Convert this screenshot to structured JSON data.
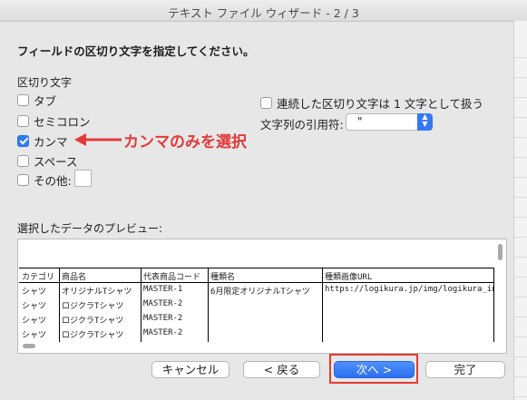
{
  "window": {
    "title": "テキスト ファイル ウィザード - 2 / 3"
  },
  "instruction": "フィールドの区切り文字を指定してください。",
  "delimiters": {
    "section_label": "区切り文字",
    "options": [
      {
        "label": "タブ",
        "checked": false
      },
      {
        "label": "セミコロン",
        "checked": false
      },
      {
        "label": "カンマ",
        "checked": true
      },
      {
        "label": "スペース",
        "checked": false
      },
      {
        "label": "その他:",
        "checked": false
      }
    ],
    "other_value": ""
  },
  "consecutive": {
    "label": "連続した区切り文字は 1 文字として扱う",
    "checked": false
  },
  "text_qualifier": {
    "label": "文字列の引用符:",
    "value": "\""
  },
  "annotation": {
    "text": "カンマのみを選択",
    "color": "#e23a39"
  },
  "preview": {
    "label": "選択したデータのプレビュー:",
    "headers": [
      "カテゴリ",
      "商品名",
      "代表商品コード",
      "種類名",
      "種類画像URL"
    ],
    "rows": [
      [
        "シャツ",
        "オリジナルTシャツ",
        "MASTER-1",
        "6月限定オリジナルTシャツ",
        "https://logikura.jp/img/logikura_indig"
      ],
      [
        "シャツ",
        "ロジクラTシャツ",
        "MASTER-2",
        "",
        ""
      ],
      [
        "シャツ",
        "ロジクラTシャツ",
        "MASTER-2",
        "",
        ""
      ],
      [
        "シャツ",
        "ロジクラTシャツ",
        "MASTER-2",
        "",
        ""
      ]
    ]
  },
  "buttons": {
    "cancel": "キャンセル",
    "back": "< 戻る",
    "next": "次へ >",
    "finish": "完了"
  },
  "colors": {
    "accent": "#2f7bf6",
    "highlight": "#e53a33"
  }
}
